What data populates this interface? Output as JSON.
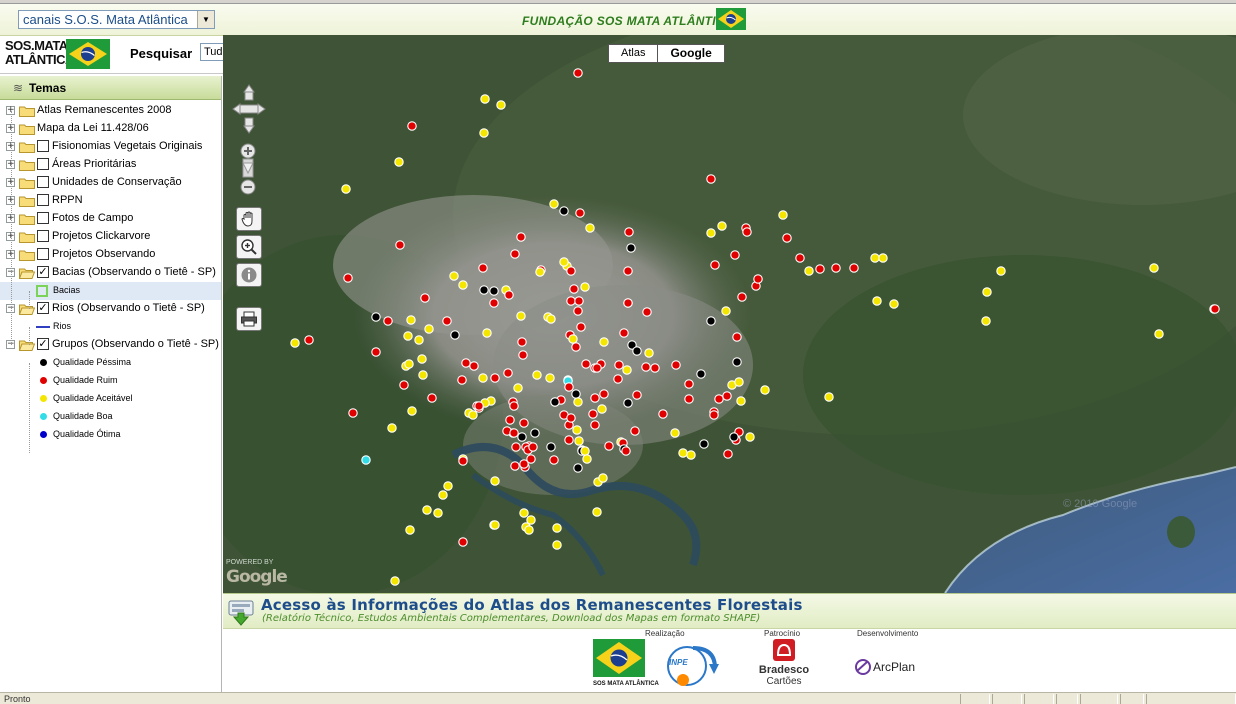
{
  "window": {
    "status_text": "Pronto"
  },
  "header": {
    "channel_select": "canais S.O.S. Mata Atlântica",
    "foundation_title": "FUNDAÇÃO SOS MATA ATLÂNTICA",
    "logo_text_line1": "SOS.MATA",
    "logo_text_line2": "ATLÂNTICA"
  },
  "search": {
    "label": "Pesquisar",
    "scope": "Tudo",
    "query": ""
  },
  "map_toggle": {
    "atlas": "Atlas",
    "google": "Google"
  },
  "panel": {
    "title": "Temas",
    "items": [
      {
        "label": "Atlas Remanescentes 2008",
        "checkbox": false,
        "expanded": false
      },
      {
        "label": "Mapa da Lei 11.428/06",
        "checkbox": false,
        "expanded": false
      },
      {
        "label": "Fisionomias Vegetais Originais",
        "checkbox": true,
        "checked": false,
        "expanded": false
      },
      {
        "label": "Áreas Prioritárias",
        "checkbox": true,
        "checked": false,
        "expanded": false
      },
      {
        "label": "Unidades de Conservação",
        "checkbox": true,
        "checked": false,
        "expanded": false
      },
      {
        "label": "RPPN",
        "checkbox": true,
        "checked": false,
        "expanded": false
      },
      {
        "label": "Fotos de Campo",
        "checkbox": true,
        "checked": false,
        "expanded": false
      },
      {
        "label": "Projetos Clickarvore",
        "checkbox": true,
        "checked": false,
        "expanded": false
      },
      {
        "label": "Projetos Observando",
        "checkbox": true,
        "checked": false,
        "expanded": false
      },
      {
        "label": "Bacias (Observando o Tietê - SP)",
        "checkbox": true,
        "checked": true,
        "expanded": true
      },
      {
        "label": "Rios (Observando o Tietê - SP)",
        "checkbox": true,
        "checked": true,
        "expanded": true
      },
      {
        "label": "Grupos (Observando o Tietê - SP)",
        "checkbox": true,
        "checked": true,
        "expanded": true
      }
    ],
    "legend_bacias": "Bacias",
    "legend_rios": "Rios",
    "legend_groups": [
      {
        "label": "Qualidade Péssima",
        "color": "#000000"
      },
      {
        "label": "Qualidade Ruim",
        "color": "#e00000"
      },
      {
        "label": "Qualidade Aceitável",
        "color": "#f5e600"
      },
      {
        "label": "Qualidade Boa",
        "color": "#33dde8"
      },
      {
        "label": "Qualidade Ótima",
        "color": "#0000cc"
      }
    ]
  },
  "map": {
    "powered_by": "POWERED BY",
    "google_logo": "Google",
    "copyright": "© 2010 Google",
    "tools": [
      "pan-hand-icon",
      "zoom-box-icon",
      "info-icon",
      "print-icon"
    ]
  },
  "info_panel": {
    "heading": "Acesso às Informações do Atlas dos Remanescentes Florestais",
    "subheading": "(Relatório Técnico, Estudos Ambientais Complementares, Download dos Mapas em formato SHAPE)",
    "sponsors": {
      "realizacao": "Realização",
      "patrocinio": "Patrocínio",
      "desenvolvimento": "Desenvolvimento",
      "sos_logo_caption": "SOS MATA ATLÂNTICA",
      "inpe": "INPE",
      "bradesco": "Bradesco",
      "cartoes": "Cartões",
      "arcplan": "ArcPlan"
    }
  }
}
